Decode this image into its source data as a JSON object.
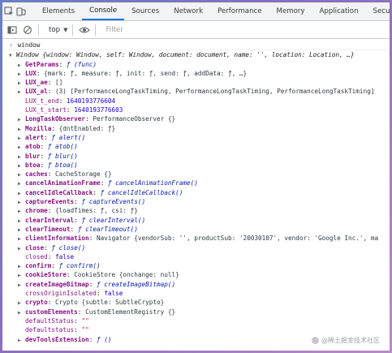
{
  "tabs": [
    "Elements",
    "Console",
    "Sources",
    "Network",
    "Performance",
    "Memory",
    "Application",
    "Security"
  ],
  "active_tab": "Console",
  "toolbar": {
    "context": "top",
    "filter_placeholder": "Filter"
  },
  "console_input": "window",
  "window_summary": "Window {window: Window, self: Window, document: document, name: '', location: Location, …}",
  "rows": [
    {
      "arrow": "▶",
      "key": "GetParams",
      "sep": ": ",
      "value": "ƒ (func)",
      "kind": "fn"
    },
    {
      "arrow": "▶",
      "key": "LUX",
      "sep": ": ",
      "value": "{mark: ƒ, measure: ƒ, init: ƒ, send: ƒ, addData: ƒ, …}",
      "kind": "plain"
    },
    {
      "arrow": "▶",
      "key": "LUX_ae",
      "sep": ": ",
      "value": "[]",
      "kind": "plain"
    },
    {
      "arrow": "▶",
      "key": "LUX_al",
      "sep": ": ",
      "value": "(3) [PerformanceLongTaskTiming, PerformanceLongTaskTiming, PerformanceLongTaskTiming]",
      "kind": "plain"
    },
    {
      "arrow": "",
      "key": "LUX_t_end",
      "sep": ": ",
      "value": "1640193776604",
      "kind": "num"
    },
    {
      "arrow": "",
      "key": "LUX_t_start",
      "sep": ": ",
      "value": "1640193776603",
      "kind": "num"
    },
    {
      "arrow": "▶",
      "key": "LongTaskObserver",
      "sep": ": ",
      "value": "PerformanceObserver {}",
      "kind": "plain"
    },
    {
      "arrow": "▶",
      "key": "Mozilla",
      "sep": ": ",
      "value": "{dntEnabled: ƒ}",
      "kind": "plain"
    },
    {
      "arrow": "▶",
      "key": "alert",
      "sep": ": ",
      "value": "ƒ alert()",
      "kind": "fn"
    },
    {
      "arrow": "▶",
      "key": "atob",
      "sep": ": ",
      "value": "ƒ atob()",
      "kind": "fn"
    },
    {
      "arrow": "▶",
      "key": "blur",
      "sep": ": ",
      "value": "ƒ blur()",
      "kind": "fn"
    },
    {
      "arrow": "▶",
      "key": "btoa",
      "sep": ": ",
      "value": "ƒ btoa()",
      "kind": "fn"
    },
    {
      "arrow": "▶",
      "key": "caches",
      "sep": ": ",
      "value": "CacheStorage {}",
      "kind": "plain"
    },
    {
      "arrow": "▶",
      "key": "cancelAnimationFrame",
      "sep": ": ",
      "value": "ƒ cancelAnimationFrame()",
      "kind": "fn"
    },
    {
      "arrow": "▶",
      "key": "cancelIdleCallback",
      "sep": ": ",
      "value": "ƒ cancelIdleCallback()",
      "kind": "fn"
    },
    {
      "arrow": "▶",
      "key": "captureEvents",
      "sep": ": ",
      "value": "ƒ captureEvents()",
      "kind": "fn"
    },
    {
      "arrow": "▶",
      "key": "chrome",
      "sep": ": ",
      "value": "{loadTimes: ƒ, csi: ƒ}",
      "kind": "plain"
    },
    {
      "arrow": "▶",
      "key": "clearInterval",
      "sep": ": ",
      "value": "ƒ clearInterval()",
      "kind": "fn"
    },
    {
      "arrow": "▶",
      "key": "clearTimeout",
      "sep": ": ",
      "value": "ƒ clearTimeout()",
      "kind": "fn"
    },
    {
      "arrow": "▶",
      "key": "clientInformation",
      "sep": ": ",
      "value": "Navigator {vendorSub: '', productSub: '20030107', vendor: 'Google Inc.', ma",
      "kind": "plain"
    },
    {
      "arrow": "▶",
      "key": "close",
      "sep": ": ",
      "value": "ƒ close()",
      "kind": "fn"
    },
    {
      "arrow": "",
      "key": "closed",
      "sep": ": ",
      "value": "false",
      "kind": "num"
    },
    {
      "arrow": "▶",
      "key": "confirm",
      "sep": ": ",
      "value": "ƒ confirm()",
      "kind": "fn"
    },
    {
      "arrow": "▶",
      "key": "cookieStore",
      "sep": ": ",
      "value": "CookieStore {onchange: null}",
      "kind": "plain"
    },
    {
      "arrow": "▶",
      "key": "createImageBitmap",
      "sep": ": ",
      "value": "ƒ createImageBitmap()",
      "kind": "fn"
    },
    {
      "arrow": "",
      "key": "crossOriginIsolated",
      "sep": ": ",
      "value": "false",
      "kind": "num"
    },
    {
      "arrow": "▶",
      "key": "crypto",
      "sep": ": ",
      "value": "Crypto {subtle: SubtleCrypto}",
      "kind": "plain"
    },
    {
      "arrow": "▶",
      "key": "customElements",
      "sep": ": ",
      "value": "CustomElementRegistry {}",
      "kind": "plain"
    },
    {
      "arrow": "",
      "key": "defaultStatus",
      "sep": ": ",
      "value": "\"\"",
      "kind": "str"
    },
    {
      "arrow": "",
      "key": "defaultstatus",
      "sep": ": ",
      "value": "\"\"",
      "kind": "str"
    },
    {
      "arrow": "▶",
      "key": "devToolsExtension",
      "sep": ": ",
      "value": "ƒ ()",
      "kind": "fn"
    }
  ],
  "watermark": "@稀土掘金技术社区",
  "colors": {
    "accent": "#1a73e8",
    "key": "#881280",
    "string": "#c41a16",
    "number": "#1c00cf",
    "function": "#0d22aa"
  }
}
